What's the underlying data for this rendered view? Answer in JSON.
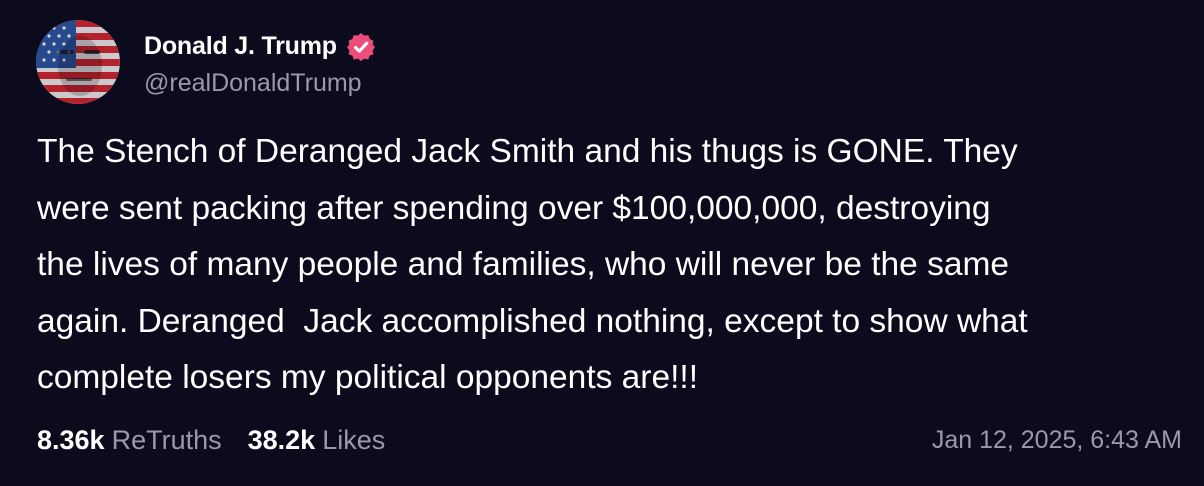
{
  "post": {
    "author": {
      "display_name": "Donald J. Trump",
      "handle": "@realDonaldTrump",
      "verified": true,
      "avatar_icon": "flag-portrait-avatar",
      "verified_icon": "verified-badge-icon"
    },
    "text": "The Stench of Deranged Jack Smith and his thugs is GONE. They\nwere sent packing after spending over $100,000,000, destroying\nthe lives of many people and families, who will never be the same\nagain. Deranged  Jack accomplished nothing, except to show what\ncomplete losers my political opponents are!!!",
    "stats": {
      "retruths_count": "8.36k",
      "retruths_label": "ReTruths",
      "likes_count": "38.2k",
      "likes_label": "Likes"
    },
    "timestamp": "Jan 12, 2025, 6:43 AM"
  },
  "colors": {
    "background": "#0c0a1d",
    "primary_text": "#ffffff",
    "secondary_text": "#9a98ab",
    "verified_badge": "#ec4e7b"
  }
}
